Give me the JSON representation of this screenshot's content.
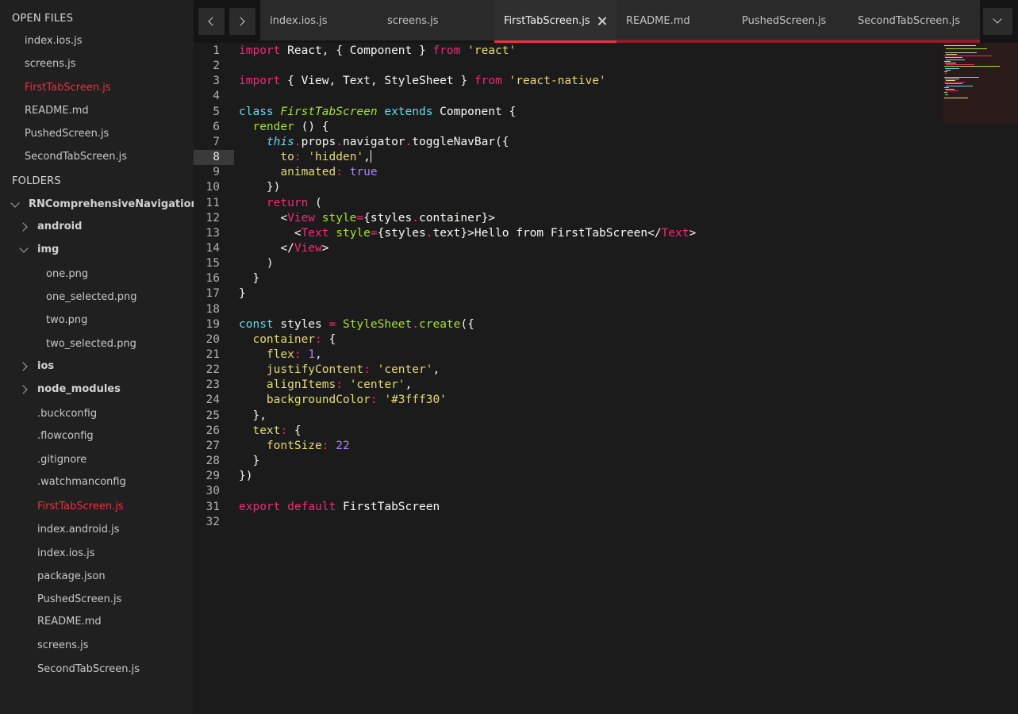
{
  "sidebar": {
    "open_files_header": "OPEN FILES",
    "open_files": [
      {
        "label": "index.ios.js",
        "active": false
      },
      {
        "label": "screens.js",
        "active": false
      },
      {
        "label": "FirstTabScreen.js",
        "active": true
      },
      {
        "label": "README.md",
        "active": false
      },
      {
        "label": "PushedScreen.js",
        "active": false
      },
      {
        "label": "SecondTabScreen.js",
        "active": false
      }
    ],
    "folders_header": "FOLDERS",
    "root_folder": "RNComprehensiveNavigation",
    "tree": {
      "android": "android",
      "img": "img",
      "img_files": [
        "one.png",
        "one_selected.png",
        "two.png",
        "two_selected.png"
      ],
      "ios": "ios",
      "node_modules": "node_modules",
      "files": [
        {
          "label": ".buckconfig",
          "active": false
        },
        {
          "label": ".flowconfig",
          "active": false
        },
        {
          "label": ".gitignore",
          "active": false
        },
        {
          "label": ".watchmanconfig",
          "active": false
        },
        {
          "label": "FirstTabScreen.js",
          "active": true
        },
        {
          "label": "index.android.js",
          "active": false
        },
        {
          "label": "index.ios.js",
          "active": false
        },
        {
          "label": "package.json",
          "active": false
        },
        {
          "label": "PushedScreen.js",
          "active": false
        },
        {
          "label": "README.md",
          "active": false
        },
        {
          "label": "screens.js",
          "active": false
        },
        {
          "label": "SecondTabScreen.js",
          "active": false
        }
      ]
    }
  },
  "tabs": [
    {
      "label": "index.ios.js",
      "active": false
    },
    {
      "label": "screens.js",
      "active": false
    },
    {
      "label": "FirstTabScreen.js",
      "active": true
    },
    {
      "label": "README.md",
      "active": false
    },
    {
      "label": "PushedScreen.js",
      "active": false
    },
    {
      "label": "SecondTabScreen.js",
      "active": false
    }
  ],
  "editor": {
    "current_line": 8,
    "line_count": 32
  },
  "icons": {
    "back": "chevron-left-icon",
    "forward": "chevron-right-icon",
    "close": "close-icon",
    "tab_menu": "chevron-down-icon",
    "expand": "chevron-right-icon",
    "collapse": "chevron-down-icon"
  },
  "colors": {
    "accent": "#ee2f41",
    "keyword": "#f92672",
    "string": "#e6db74",
    "function": "#a6e22e",
    "storage": "#66d9ef",
    "number": "#ae81ff"
  },
  "code": [
    [
      [
        "t-kw",
        "import"
      ],
      [
        "t-txt",
        " React, { Component } "
      ],
      [
        "t-kw",
        "from"
      ],
      [
        "t-txt",
        " "
      ],
      [
        "t-str",
        "'react'"
      ]
    ],
    [],
    [
      [
        "t-kw",
        "import"
      ],
      [
        "t-txt",
        " { View, Text, StyleSheet } "
      ],
      [
        "t-kw",
        "from"
      ],
      [
        "t-txt",
        " "
      ],
      [
        "t-str",
        "'react-native'"
      ]
    ],
    [],
    [
      [
        "t-blue",
        "class"
      ],
      [
        "t-txt",
        " "
      ],
      [
        "t-green-i",
        "FirstTabScreen"
      ],
      [
        "t-txt",
        " "
      ],
      [
        "t-blue",
        "extends"
      ],
      [
        "t-txt",
        " Component {"
      ]
    ],
    [
      [
        "t-txt",
        "  "
      ],
      [
        "t-green",
        "render"
      ],
      [
        "t-txt",
        " () {"
      ]
    ],
    [
      [
        "t-txt",
        "    "
      ],
      [
        "t-blue-i",
        "this"
      ],
      [
        "t-kw",
        "."
      ],
      [
        "t-txt",
        "props"
      ],
      [
        "t-kw",
        "."
      ],
      [
        "t-txt",
        "navigator"
      ],
      [
        "t-kw",
        "."
      ],
      [
        "t-txt",
        "toggleNavBar({"
      ]
    ],
    [
      [
        "t-txt",
        "      "
      ],
      [
        "t-prop",
        "to"
      ],
      [
        "t-kw",
        ":"
      ],
      [
        "t-txt",
        " "
      ],
      [
        "t-str",
        "'hidden'"
      ],
      [
        "t-txt",
        ","
      ],
      [
        "cursor",
        ""
      ]
    ],
    [
      [
        "t-txt",
        "      "
      ],
      [
        "t-prop",
        "animated"
      ],
      [
        "t-kw",
        ":"
      ],
      [
        "t-txt",
        " "
      ],
      [
        "t-num",
        "true"
      ]
    ],
    [
      [
        "t-txt",
        "    })"
      ]
    ],
    [
      [
        "t-txt",
        "    "
      ],
      [
        "t-kw",
        "return"
      ],
      [
        "t-txt",
        " ("
      ]
    ],
    [
      [
        "t-txt",
        "      <"
      ],
      [
        "t-kw",
        "View"
      ],
      [
        "t-txt",
        " "
      ],
      [
        "t-green",
        "style"
      ],
      [
        "t-kw",
        "="
      ],
      [
        "t-txt",
        "{styles"
      ],
      [
        "t-kw",
        "."
      ],
      [
        "t-txt",
        "container}>"
      ]
    ],
    [
      [
        "t-txt",
        "        <"
      ],
      [
        "t-kw",
        "Text"
      ],
      [
        "t-txt",
        " "
      ],
      [
        "t-green",
        "style"
      ],
      [
        "t-kw",
        "="
      ],
      [
        "t-txt",
        "{styles"
      ],
      [
        "t-kw",
        "."
      ],
      [
        "t-txt",
        "text}>Hello from FirstTabScreen</"
      ],
      [
        "t-kw",
        "Text"
      ],
      [
        "t-txt",
        ">"
      ]
    ],
    [
      [
        "t-txt",
        "      </"
      ],
      [
        "t-kw",
        "View"
      ],
      [
        "t-txt",
        ">"
      ]
    ],
    [
      [
        "t-txt",
        "    )"
      ]
    ],
    [
      [
        "t-txt",
        "  }"
      ]
    ],
    [
      [
        "t-txt",
        "}"
      ]
    ],
    [],
    [
      [
        "t-blue",
        "const"
      ],
      [
        "t-txt",
        " styles "
      ],
      [
        "t-kw",
        "="
      ],
      [
        "t-txt",
        " "
      ],
      [
        "t-green",
        "StyleSheet"
      ],
      [
        "t-kw",
        "."
      ],
      [
        "t-green",
        "create"
      ],
      [
        "t-txt",
        "({"
      ]
    ],
    [
      [
        "t-txt",
        "  "
      ],
      [
        "t-prop",
        "container"
      ],
      [
        "t-kw",
        ":"
      ],
      [
        "t-txt",
        " {"
      ]
    ],
    [
      [
        "t-txt",
        "    "
      ],
      [
        "t-prop",
        "flex"
      ],
      [
        "t-kw",
        ":"
      ],
      [
        "t-txt",
        " "
      ],
      [
        "t-num",
        "1"
      ],
      [
        "t-txt",
        ","
      ]
    ],
    [
      [
        "t-txt",
        "    "
      ],
      [
        "t-prop",
        "justifyContent"
      ],
      [
        "t-kw",
        ":"
      ],
      [
        "t-txt",
        " "
      ],
      [
        "t-str",
        "'center'"
      ],
      [
        "t-txt",
        ","
      ]
    ],
    [
      [
        "t-txt",
        "    "
      ],
      [
        "t-prop",
        "alignItems"
      ],
      [
        "t-kw",
        ":"
      ],
      [
        "t-txt",
        " "
      ],
      [
        "t-str",
        "'center'"
      ],
      [
        "t-txt",
        ","
      ]
    ],
    [
      [
        "t-txt",
        "    "
      ],
      [
        "t-prop",
        "backgroundColor"
      ],
      [
        "t-kw",
        ":"
      ],
      [
        "t-txt",
        " "
      ],
      [
        "t-str",
        "'#3fff30'"
      ]
    ],
    [
      [
        "t-txt",
        "  },"
      ]
    ],
    [
      [
        "t-txt",
        "  "
      ],
      [
        "t-prop",
        "text"
      ],
      [
        "t-kw",
        ":"
      ],
      [
        "t-txt",
        " {"
      ]
    ],
    [
      [
        "t-txt",
        "    "
      ],
      [
        "t-prop",
        "fontSize"
      ],
      [
        "t-kw",
        ":"
      ],
      [
        "t-txt",
        " "
      ],
      [
        "t-num",
        "22"
      ]
    ],
    [
      [
        "t-txt",
        "  }"
      ]
    ],
    [
      [
        "t-txt",
        "})"
      ]
    ],
    [],
    [
      [
        "t-kw",
        "export"
      ],
      [
        "t-txt",
        " "
      ],
      [
        "t-kw",
        "default"
      ],
      [
        "t-txt",
        " FirstTabScreen"
      ]
    ],
    []
  ]
}
